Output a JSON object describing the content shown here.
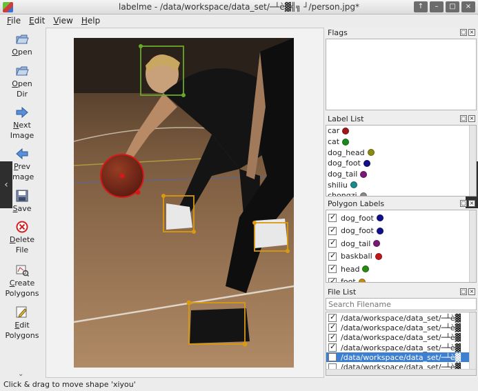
{
  "window": {
    "title": "labelme - /data/workspace/data_set/─┴è▓╣╗ ┘/person.jpg*",
    "buttons": [
      "↑",
      "–",
      "□",
      "×"
    ]
  },
  "menu": [
    "File",
    "Edit",
    "View",
    "Help"
  ],
  "toolbar": [
    {
      "label": "Open",
      "icon": "folder-icon"
    },
    {
      "label": "Open\nDir",
      "icon": "folder-icon"
    },
    {
      "label": "Next\nImage",
      "icon": "arrow-right-icon"
    },
    {
      "label": "Prev\nImage",
      "icon": "arrow-left-icon"
    },
    {
      "label": "Save",
      "icon": "floppy-icon"
    },
    {
      "label": "Delete\nFile",
      "icon": "delete-icon"
    },
    {
      "label": "Create\nPolygons",
      "icon": "polygon-icon"
    },
    {
      "label": "Edit\nPolygons",
      "icon": "pencil-icon"
    }
  ],
  "docks": {
    "flags": {
      "title": "Flags"
    },
    "label_list": {
      "title": "Label List",
      "items": [
        {
          "name": "car",
          "color": "#a01818"
        },
        {
          "name": "cat",
          "color": "#1b8a1b"
        },
        {
          "name": "dog_head",
          "color": "#8a8a10"
        },
        {
          "name": "dog_foot",
          "color": "#10108a"
        },
        {
          "name": "dog_tail",
          "color": "#7a187a"
        },
        {
          "name": "shiliu",
          "color": "#188a8a"
        },
        {
          "name": "chongzi",
          "color": "#888888"
        }
      ]
    },
    "polygon_labels": {
      "title": "Polygon Labels",
      "items": [
        {
          "name": "dog_foot",
          "color": "#10108a",
          "checked": true
        },
        {
          "name": "dog_foot",
          "color": "#10108a",
          "checked": true
        },
        {
          "name": "dog_tail",
          "color": "#7a187a",
          "checked": true
        },
        {
          "name": "baskball",
          "color": "#c01818",
          "checked": true
        },
        {
          "name": "head",
          "color": "#2a8a10",
          "checked": true
        },
        {
          "name": "foot",
          "color": "#c88a10",
          "checked": true
        }
      ]
    },
    "file_list": {
      "title": "File List",
      "search_placeholder": "Search Filename",
      "items": [
        {
          "path": "/data/workspace/data_set/─┴è▓",
          "checked": true,
          "selected": false
        },
        {
          "path": "/data/workspace/data_set/─┴è▓",
          "checked": true,
          "selected": false
        },
        {
          "path": "/data/workspace/data_set/─┴è▓",
          "checked": true,
          "selected": false
        },
        {
          "path": "/data/workspace/data_set/─┴è▓",
          "checked": true,
          "selected": false
        },
        {
          "path": "/data/workspace/data_set/─┴è▓",
          "checked": false,
          "selected": true
        },
        {
          "path": "/data/workspace/data_set/─┴è▓",
          "checked": false,
          "selected": false
        }
      ]
    }
  },
  "status": "Click & drag to move shape 'xiyou'",
  "colors": {
    "head_box": "#6aa82a",
    "foot_box": "#d89a10",
    "ball_circle": "#d81818",
    "selected_row": "#3d7fd0"
  }
}
